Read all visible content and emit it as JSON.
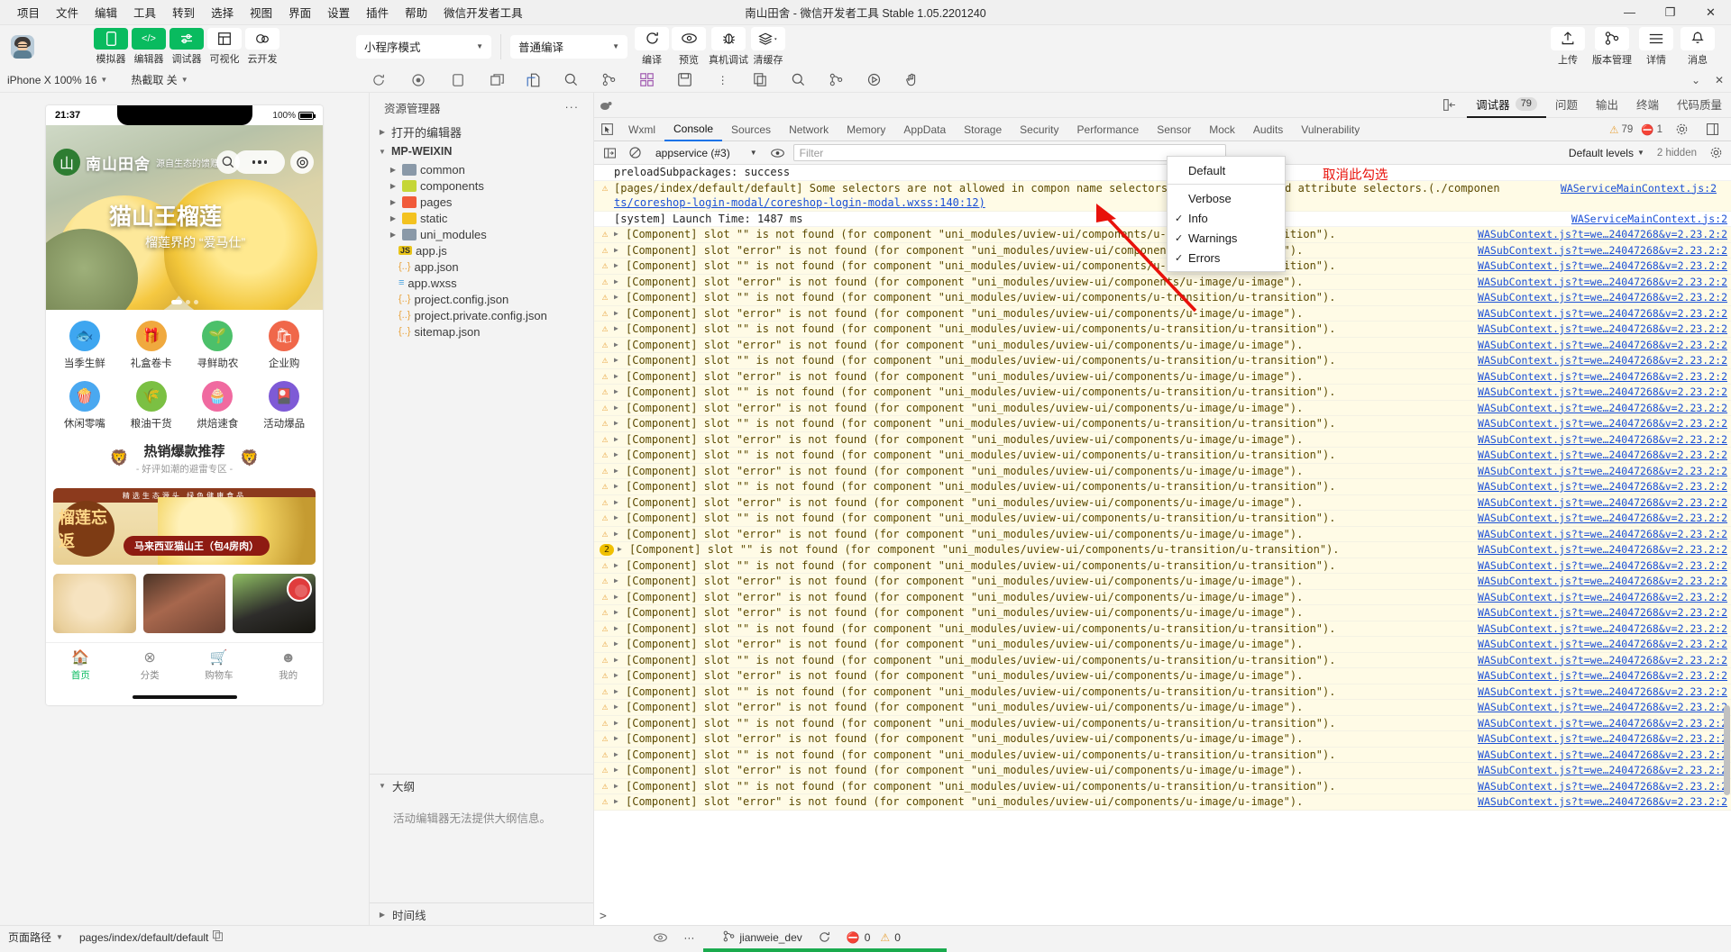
{
  "window": {
    "title": "南山田舍 - 微信开发者工具 Stable 1.05.2201240",
    "menus": [
      "项目",
      "文件",
      "编辑",
      "工具",
      "转到",
      "选择",
      "视图",
      "界面",
      "设置",
      "插件",
      "帮助",
      "微信开发者工具"
    ],
    "controls": {
      "minimize": "—",
      "maximize": "❐",
      "close": "✕"
    }
  },
  "toolbar": {
    "mode_select": "小程序模式",
    "compile_select": "普通编译",
    "left_buttons": [
      {
        "label": "模拟器",
        "icon": "phone-icon",
        "green": true
      },
      {
        "label": "编辑器",
        "icon": "code-icon",
        "green": true
      },
      {
        "label": "调试器",
        "icon": "sliders-icon",
        "green": true
      },
      {
        "label": "可视化",
        "icon": "layout-icon",
        "green": false
      },
      {
        "label": "云开发",
        "icon": "cloud-icon",
        "green": false
      }
    ],
    "action_buttons": [
      {
        "label": "编译",
        "icon": "refresh-icon"
      },
      {
        "label": "预览",
        "icon": "eye-icon"
      },
      {
        "label": "真机调试",
        "icon": "bug-icon"
      },
      {
        "label": "清缓存",
        "icon": "layers-icon"
      }
    ],
    "right_buttons": [
      {
        "label": "上传",
        "icon": "upload-icon"
      },
      {
        "label": "版本管理",
        "icon": "branch-icon"
      },
      {
        "label": "详情",
        "icon": "menu-icon"
      },
      {
        "label": "消息",
        "icon": "bell-icon"
      }
    ]
  },
  "subbar": {
    "device": "iPhone X 100% 16",
    "screenshot": "热截取 关",
    "icons": [
      "refresh-icon",
      "record-icon",
      "rotate-icon",
      "split-icon"
    ],
    "right_icons": [
      "minimize-icon",
      "close-icon"
    ]
  },
  "simulator": {
    "status": {
      "time": "21:37",
      "battery_label": "100%"
    },
    "brand": {
      "name": "南山田舍",
      "slogan": "源自生态的馈赠"
    },
    "hero": {
      "title": "猫山王榴莲",
      "subtitle": "榴莲界的 “爱马仕”"
    },
    "categories": [
      {
        "label": "当季生鲜",
        "icon": "fish-icon",
        "color": "#3ea6f0"
      },
      {
        "label": "礼盒卷卡",
        "icon": "gift-icon",
        "color": "#f0a93e"
      },
      {
        "label": "寻鲜助农",
        "icon": "sprout-icon",
        "color": "#4cc06a"
      },
      {
        "label": "企业购",
        "icon": "cart-icon",
        "color": "#f0674a"
      },
      {
        "label": "休闲零嘴",
        "icon": "snack-icon",
        "color": "#4aa8f0"
      },
      {
        "label": "粮油干货",
        "icon": "grain-icon",
        "color": "#7bc043"
      },
      {
        "label": "烘焙速食",
        "icon": "cake-icon",
        "color": "#f06aa0"
      },
      {
        "label": "活动爆品",
        "icon": "fire-icon",
        "color": "#7e5ad6"
      }
    ],
    "promo": {
      "title": "热销爆款推荐",
      "subtitle": "- 好评如潮的避雷专区 -"
    },
    "banner": {
      "topbar": "精选生态源头 绿色健康食品",
      "badge": "榴莲忘返",
      "pill": "马来西亚猫山王（包4房肉）"
    },
    "tabbar": [
      {
        "label": "首页",
        "icon": "home-icon",
        "active": true
      },
      {
        "label": "分类",
        "icon": "grid-icon",
        "active": false
      },
      {
        "label": "购物车",
        "icon": "cart-icon",
        "active": false
      },
      {
        "label": "我的",
        "icon": "user-icon",
        "active": false
      }
    ]
  },
  "explorer": {
    "title": "资源管理器",
    "more": "···",
    "open_editors": "打开的编辑器",
    "project": "MP-WEIXIN",
    "folders": [
      {
        "name": "common",
        "color": "gray"
      },
      {
        "name": "components",
        "color": "lime"
      },
      {
        "name": "pages",
        "color": "red"
      },
      {
        "name": "static",
        "color": "yellow"
      },
      {
        "name": "uni_modules",
        "color": "gray"
      }
    ],
    "files": [
      {
        "name": "app.js",
        "type": "js"
      },
      {
        "name": "app.json",
        "type": "json"
      },
      {
        "name": "app.wxss",
        "type": "wxss"
      },
      {
        "name": "project.config.json",
        "type": "json"
      },
      {
        "name": "project.private.config.json",
        "type": "json"
      },
      {
        "name": "sitemap.json",
        "type": "json"
      }
    ],
    "outline_title": "大纲",
    "outline_empty": "活动编辑器无法提供大纲信息。",
    "timeline_title": "时间线"
  },
  "devtools": {
    "panel_tabs": [
      {
        "label": "调试器",
        "badge": "79",
        "active": true
      },
      {
        "label": "问题",
        "badge": "",
        "active": false
      },
      {
        "label": "输出",
        "badge": "",
        "active": false
      },
      {
        "label": "终端",
        "badge": "",
        "active": false
      },
      {
        "label": "代码质量",
        "badge": "",
        "active": false
      }
    ],
    "inner_tabs": [
      "Wxml",
      "Console",
      "Sources",
      "Network",
      "Memory",
      "AppData",
      "Storage",
      "Security",
      "Performance",
      "Sensor",
      "Mock",
      "Audits",
      "Vulnerability"
    ],
    "active_inner_tab": "Console",
    "warning_count": "79",
    "error_count": "1",
    "context": "appservice (#3)",
    "filter_placeholder": "Filter",
    "levels_label": "Default levels",
    "hidden_note": "2 hidden"
  },
  "level_menu": {
    "items": [
      {
        "label": "Default",
        "checked": false,
        "separator_after": true
      },
      {
        "label": "Verbose",
        "checked": false
      },
      {
        "label": "Info",
        "checked": true
      },
      {
        "label": "Warnings",
        "checked": true
      },
      {
        "label": "Errors",
        "checked": true
      }
    ]
  },
  "annotation": {
    "text": "取消此勾选",
    "color": "#e8110a"
  },
  "console": {
    "source_link": "WAServiceMainContext.js:2",
    "sub_link": "WASubContext.js?t=we…24047268&v=2.23.2:2",
    "lines": [
      {
        "type": "plain",
        "text": "preloadSubpackages: success",
        "src": ""
      },
      {
        "type": "warn2",
        "text": "[pages/index/default/default] Some selectors are not allowed in compon",
        "text2": "ts/coreshop-login-modal/coreshop-login-modal.wxss:140:12)",
        "tail": "name selectors, ID selectors, and attribute selectors.(./componen",
        "src": "WAServiceMainContext.js:2"
      },
      {
        "type": "plain",
        "text": "[system] Launch Time: 1487 ms",
        "src": "WAServiceMainContext.js:2"
      },
      {
        "type": "warn",
        "text": "[Component] slot \"\" is not found (for component \"uni_modules/uview-ui/components/u-transition/u-transition\").",
        "src": "WASubContext.js?t=we…24047268&v=2.23.2:2"
      },
      {
        "type": "warn",
        "text": "[Component] slot \"error\" is not found (for component \"uni_modules/uview-ui/components/u-image/u-image\").",
        "src": "WASubContext.js?t=we…24047268&v=2.23.2:2"
      },
      {
        "type": "warn",
        "text": "[Component] slot \"\" is not found (for component \"uni_modules/uview-ui/components/u-transition/u-transition\").",
        "src": "WASubContext.js?t=we…24047268&v=2.23.2:2"
      },
      {
        "type": "warn",
        "text": "[Component] slot \"error\" is not found (for component \"uni_modules/uview-ui/components/u-image/u-image\").",
        "src": "WASubContext.js?t=we…24047268&v=2.23.2:2"
      },
      {
        "type": "warn",
        "text": "[Component] slot \"\" is not found (for component \"uni_modules/uview-ui/components/u-transition/u-transition\").",
        "src": "WASubContext.js?t=we…24047268&v=2.23.2:2"
      },
      {
        "type": "warn",
        "text": "[Component] slot \"error\" is not found (for component \"uni_modules/uview-ui/components/u-image/u-image\").",
        "src": "WASubContext.js?t=we…24047268&v=2.23.2:2"
      },
      {
        "type": "warn",
        "text": "[Component] slot \"\" is not found (for component \"uni_modules/uview-ui/components/u-transition/u-transition\").",
        "src": "WASubContext.js?t=we…24047268&v=2.23.2:2"
      },
      {
        "type": "warn",
        "text": "[Component] slot \"error\" is not found (for component \"uni_modules/uview-ui/components/u-image/u-image\").",
        "src": "WASubContext.js?t=we…24047268&v=2.23.2:2"
      },
      {
        "type": "warn",
        "text": "[Component] slot \"\" is not found (for component \"uni_modules/uview-ui/components/u-transition/u-transition\").",
        "src": "WASubContext.js?t=we…24047268&v=2.23.2:2"
      },
      {
        "type": "warn",
        "text": "[Component] slot \"error\" is not found (for component \"uni_modules/uview-ui/components/u-image/u-image\").",
        "src": "WASubContext.js?t=we…24047268&v=2.23.2:2"
      },
      {
        "type": "warn",
        "text": "[Component] slot \"\" is not found (for component \"uni_modules/uview-ui/components/u-transition/u-transition\").",
        "src": "WASubContext.js?t=we…24047268&v=2.23.2:2"
      },
      {
        "type": "warn",
        "text": "[Component] slot \"error\" is not found (for component \"uni_modules/uview-ui/components/u-image/u-image\").",
        "src": "WASubContext.js?t=we…24047268&v=2.23.2:2"
      },
      {
        "type": "warn",
        "text": "[Component] slot \"\" is not found (for component \"uni_modules/uview-ui/components/u-transition/u-transition\").",
        "src": "WASubContext.js?t=we…24047268&v=2.23.2:2"
      },
      {
        "type": "warn",
        "text": "[Component] slot \"error\" is not found (for component \"uni_modules/uview-ui/components/u-image/u-image\").",
        "src": "WASubContext.js?t=we…24047268&v=2.23.2:2"
      },
      {
        "type": "warn",
        "text": "[Component] slot \"\" is not found (for component \"uni_modules/uview-ui/components/u-transition/u-transition\").",
        "src": "WASubContext.js?t=we…24047268&v=2.23.2:2"
      },
      {
        "type": "warn",
        "text": "[Component] slot \"error\" is not found (for component \"uni_modules/uview-ui/components/u-image/u-image\").",
        "src": "WASubContext.js?t=we…24047268&v=2.23.2:2"
      },
      {
        "type": "warn",
        "text": "[Component] slot \"\" is not found (for component \"uni_modules/uview-ui/components/u-transition/u-transition\").",
        "src": "WASubContext.js?t=we…24047268&v=2.23.2:2"
      },
      {
        "type": "warn",
        "text": "[Component] slot \"error\" is not found (for component \"uni_modules/uview-ui/components/u-image/u-image\").",
        "src": "WASubContext.js?t=we…24047268&v=2.23.2:2"
      },
      {
        "type": "warn",
        "text": "[Component] slot \"\" is not found (for component \"uni_modules/uview-ui/components/u-transition/u-transition\").",
        "src": "WASubContext.js?t=we…24047268&v=2.23.2:2"
      },
      {
        "type": "warn",
        "text": "[Component] slot \"error\" is not found (for component \"uni_modules/uview-ui/components/u-image/u-image\").",
        "src": "WASubContext.js?t=we…24047268&v=2.23.2:2"
      },
      {
        "type": "count",
        "count": "2",
        "text": "[Component] slot \"\" is not found (for component \"uni_modules/uview-ui/components/u-transition/u-transition\").",
        "src": "WASubContext.js?t=we…24047268&v=2.23.2:2"
      },
      {
        "type": "warn",
        "text": "[Component] slot \"\" is not found (for component \"uni_modules/uview-ui/components/u-transition/u-transition\").",
        "src": "WASubContext.js?t=we…24047268&v=2.23.2:2"
      },
      {
        "type": "warn",
        "text": "[Component] slot \"error\" is not found (for component \"uni_modules/uview-ui/components/u-image/u-image\").",
        "src": "WASubContext.js?t=we…24047268&v=2.23.2:2"
      },
      {
        "type": "warn",
        "text": "[Component] slot \"error\" is not found (for component \"uni_modules/uview-ui/components/u-image/u-image\").",
        "src": "WASubContext.js?t=we…24047268&v=2.23.2:2"
      },
      {
        "type": "warn",
        "text": "[Component] slot \"error\" is not found (for component \"uni_modules/uview-ui/components/u-image/u-image\").",
        "src": "WASubContext.js?t=we…24047268&v=2.23.2:2"
      },
      {
        "type": "warn",
        "text": "[Component] slot \"\" is not found (for component \"uni_modules/uview-ui/components/u-transition/u-transition\").",
        "src": "WASubContext.js?t=we…24047268&v=2.23.2:2"
      },
      {
        "type": "warn",
        "text": "[Component] slot \"error\" is not found (for component \"uni_modules/uview-ui/components/u-image/u-image\").",
        "src": "WASubContext.js?t=we…24047268&v=2.23.2:2"
      },
      {
        "type": "warn",
        "text": "[Component] slot \"\" is not found (for component \"uni_modules/uview-ui/components/u-transition/u-transition\").",
        "src": "WASubContext.js?t=we…24047268&v=2.23.2:2"
      },
      {
        "type": "warn",
        "text": "[Component] slot \"error\" is not found (for component \"uni_modules/uview-ui/components/u-image/u-image\").",
        "src": "WASubContext.js?t=we…24047268&v=2.23.2:2"
      },
      {
        "type": "warn",
        "text": "[Component] slot \"\" is not found (for component \"uni_modules/uview-ui/components/u-transition/u-transition\").",
        "src": "WASubContext.js?t=we…24047268&v=2.23.2:2"
      },
      {
        "type": "warn",
        "text": "[Component] slot \"error\" is not found (for component \"uni_modules/uview-ui/components/u-image/u-image\").",
        "src": "WASubContext.js?t=we…24047268&v=2.23.2:2"
      },
      {
        "type": "warn",
        "text": "[Component] slot \"\" is not found (for component \"uni_modules/uview-ui/components/u-transition/u-transition\").",
        "src": "WASubContext.js?t=we…24047268&v=2.23.2:2"
      },
      {
        "type": "warn",
        "text": "[Component] slot \"error\" is not found (for component \"uni_modules/uview-ui/components/u-image/u-image\").",
        "src": "WASubContext.js?t=we…24047268&v=2.23.2:2"
      },
      {
        "type": "warn",
        "text": "[Component] slot \"\" is not found (for component \"uni_modules/uview-ui/components/u-transition/u-transition\").",
        "src": "WASubContext.js?t=we…24047268&v=2.23.2:2"
      },
      {
        "type": "warn",
        "text": "[Component] slot \"error\" is not found (for component \"uni_modules/uview-ui/components/u-image/u-image\").",
        "src": "WASubContext.js?t=we…24047268&v=2.23.2:2"
      },
      {
        "type": "warn",
        "text": "[Component] slot \"\" is not found (for component \"uni_modules/uview-ui/components/u-transition/u-transition\").",
        "src": "WASubContext.js?t=we…24047268&v=2.23.2:2"
      },
      {
        "type": "warn",
        "text": "[Component] slot \"error\" is not found (for component \"uni_modules/uview-ui/components/u-image/u-image\").",
        "src": "WASubContext.js?t=we…24047268&v=2.23.2:2"
      }
    ],
    "prompt": ">"
  },
  "statusbar": {
    "page_path_label": "页面路径",
    "page_path": "pages/index/default/default",
    "copy_icon": "copy-icon",
    "eye_icon": "eye-icon",
    "more": "···",
    "git_branch": "jianweie_dev",
    "sync_icon": "sync-icon",
    "error_count": "0",
    "warning_count": "0"
  }
}
